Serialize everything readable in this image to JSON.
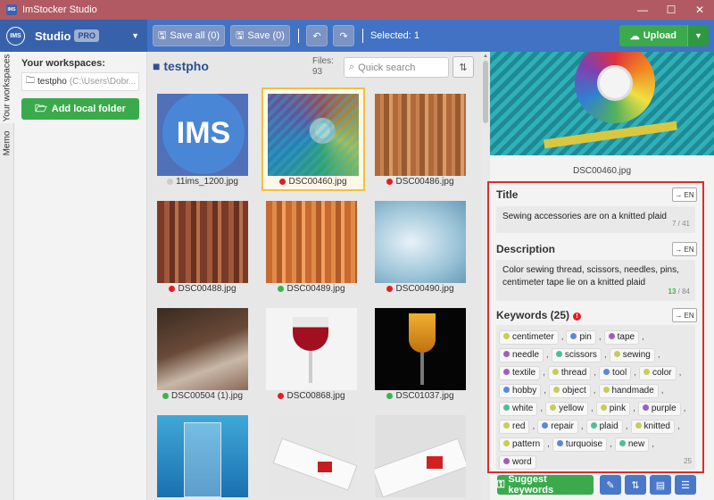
{
  "window": {
    "title": "ImStocker Studio",
    "icon_text": "IMS",
    "minimize": "—",
    "maximize": "☐",
    "close": "✕"
  },
  "toolbar": {
    "logo_text": "IMS",
    "studio_label": "Studio",
    "pro_badge": "PRO",
    "save_all": "Save all (0)",
    "save": "Save (0)",
    "selected": "Selected: 1",
    "upload": "Upload",
    "brand_color": "#4272c4",
    "accent_green": "#3aaa4c"
  },
  "side_tabs": {
    "workspaces": "Your workspaces",
    "memo": "Memo"
  },
  "workspaces": {
    "heading": "Your workspaces:",
    "items": [
      {
        "name": "testpho",
        "path": "(C:\\Users\\Dobr..."
      }
    ],
    "add_button": "Add local folder"
  },
  "files": {
    "folder": "testpho",
    "count_label": "Files:",
    "count": "93",
    "search_placeholder": "Quick search",
    "items": [
      {
        "name": "11ims_1200.jpg",
        "status": "gray"
      },
      {
        "name": "DSC00460.jpg",
        "status": "red",
        "selected": true
      },
      {
        "name": "DSC00486.jpg",
        "status": "red"
      },
      {
        "name": "DSC00488.jpg",
        "status": "red"
      },
      {
        "name": "DSC00489.jpg",
        "status": "green"
      },
      {
        "name": "DSC00490.jpg",
        "status": "red"
      },
      {
        "name": "DSC00504 (1).jpg",
        "status": "green"
      },
      {
        "name": "DSC00868.jpg",
        "status": "red"
      },
      {
        "name": "DSC01037.jpg",
        "status": "green"
      },
      {
        "name": "",
        "status": ""
      },
      {
        "name": "",
        "status": ""
      },
      {
        "name": "",
        "status": ""
      }
    ]
  },
  "preview": {
    "filename": "DSC00460.jpg"
  },
  "details": {
    "title_label": "Title",
    "title_value": "Sewing accessories are on a knitted plaid",
    "title_count": "7",
    "title_max": "41",
    "description_label": "Description",
    "description_value": "Color sewing thread, scissors, needles, pins, centimeter tape lie on a knitted plaid",
    "description_count": "13",
    "description_max": "84",
    "keywords_label": "Keywords (25)",
    "keywords_count": "25",
    "lang_button": "→ EN",
    "keywords": [
      {
        "word": "centimeter",
        "color": "#c8cc5a"
      },
      {
        "word": "pin",
        "color": "#5b8ad0"
      },
      {
        "word": "tape",
        "color": "#a05cc0"
      },
      {
        "word": "needle",
        "color": "#a05cc0"
      },
      {
        "word": "scissors",
        "color": "#4dbf9a"
      },
      {
        "word": "sewing",
        "color": "#c8cc5a"
      },
      {
        "word": "textile",
        "color": "#a05cc0"
      },
      {
        "word": "thread",
        "color": "#c8cc5a"
      },
      {
        "word": "tool",
        "color": "#5b8ad0"
      },
      {
        "word": "color",
        "color": "#c8cc5a"
      },
      {
        "word": "hobby",
        "color": "#5b8ad0"
      },
      {
        "word": "object",
        "color": "#c8cc5a"
      },
      {
        "word": "handmade",
        "color": "#c8cc5a"
      },
      {
        "word": "white",
        "color": "#4dbf9a"
      },
      {
        "word": "yellow",
        "color": "#c8cc5a"
      },
      {
        "word": "pink",
        "color": "#c8cc5a"
      },
      {
        "word": "purple",
        "color": "#a05cc0"
      },
      {
        "word": "red",
        "color": "#c8cc5a"
      },
      {
        "word": "repair",
        "color": "#5b8ad0"
      },
      {
        "word": "plaid",
        "color": "#4dbf9a"
      },
      {
        "word": "knitted",
        "color": "#c8cc5a"
      },
      {
        "word": "pattern",
        "color": "#c8cc5a"
      },
      {
        "word": "turquoise",
        "color": "#5b8ad0"
      },
      {
        "word": "new",
        "color": "#4dbf9a"
      },
      {
        "word": "word",
        "color": "#a05cc0"
      }
    ],
    "suggest_button": "Suggest keywords"
  }
}
